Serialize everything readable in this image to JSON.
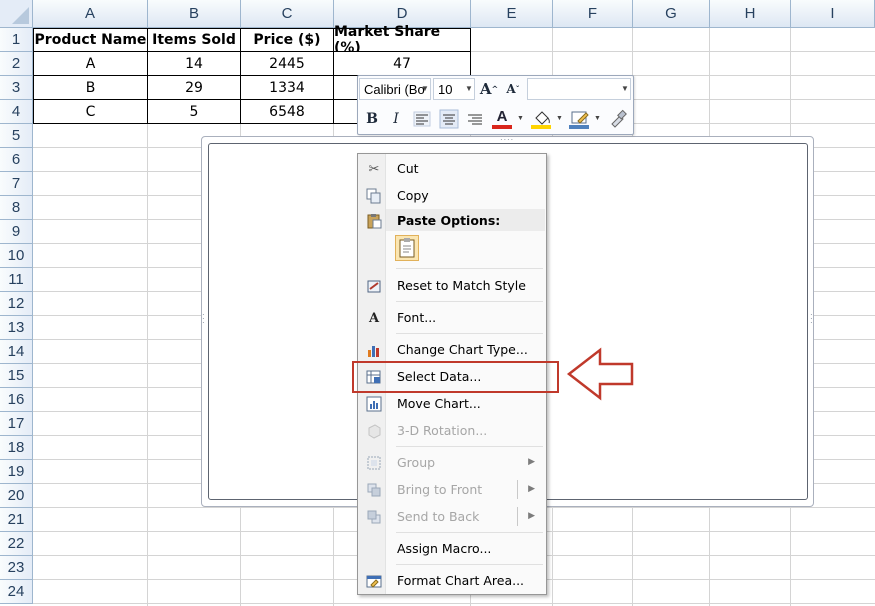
{
  "sheet": {
    "columns": [
      "A",
      "B",
      "C",
      "D",
      "E",
      "F",
      "G",
      "H",
      "I"
    ],
    "rows": [
      "1",
      "2",
      "3",
      "4",
      "5",
      "6",
      "7",
      "8",
      "9",
      "10",
      "11",
      "12",
      "13",
      "14",
      "15",
      "16",
      "17",
      "18",
      "19",
      "20",
      "21",
      "22",
      "23",
      "24"
    ],
    "headers": [
      "Product Name",
      "Items Sold",
      "Price ($)",
      "Market Share (%)"
    ],
    "data": [
      [
        "A",
        "14",
        "2445",
        "47"
      ],
      [
        "B",
        "29",
        "1334",
        ""
      ],
      [
        "C",
        "5",
        "6548",
        ""
      ]
    ]
  },
  "minitoolbar": {
    "font_name": "Calibri (Bo",
    "font_size": "10",
    "grow_font": "A",
    "shrink_font": "A",
    "bold": "B",
    "italic": "I",
    "font_color_glyph": "A",
    "font_color": "#d9261c",
    "fill_color": "#ffd400",
    "outline_color": "#4f81bd"
  },
  "context_menu": {
    "items": [
      {
        "label": "Cut",
        "icon": "scissors-icon",
        "enabled": true
      },
      {
        "label": "Copy",
        "icon": "copy-icon",
        "enabled": true
      },
      {
        "label": "Paste Options:",
        "icon": "paste-icon",
        "enabled": true
      },
      {
        "label": "Reset to Match Style",
        "icon": "reset-style-icon",
        "enabled": true
      },
      {
        "label": "Font...",
        "icon": "font-icon",
        "enabled": true
      },
      {
        "label": "Change Chart Type...",
        "icon": "chart-type-icon",
        "enabled": true
      },
      {
        "label": "Select Data...",
        "icon": "select-data-icon",
        "enabled": true
      },
      {
        "label": "Move Chart...",
        "icon": "move-chart-icon",
        "enabled": true
      },
      {
        "label": "3-D Rotation...",
        "icon": "rotation-icon",
        "enabled": false
      },
      {
        "label": "Group",
        "icon": "group-icon",
        "enabled": false,
        "submenu": true
      },
      {
        "label": "Bring to Front",
        "icon": "bring-front-icon",
        "enabled": false,
        "submenu": true
      },
      {
        "label": "Send to Back",
        "icon": "send-back-icon",
        "enabled": false,
        "submenu": true
      },
      {
        "label": "Assign Macro...",
        "icon": "",
        "enabled": true
      },
      {
        "label": "Format Chart Area...",
        "icon": "format-chart-area-icon",
        "enabled": true
      }
    ]
  },
  "annotation": {
    "highlight_color": "#c0392b",
    "target_item": "Select Data..."
  }
}
